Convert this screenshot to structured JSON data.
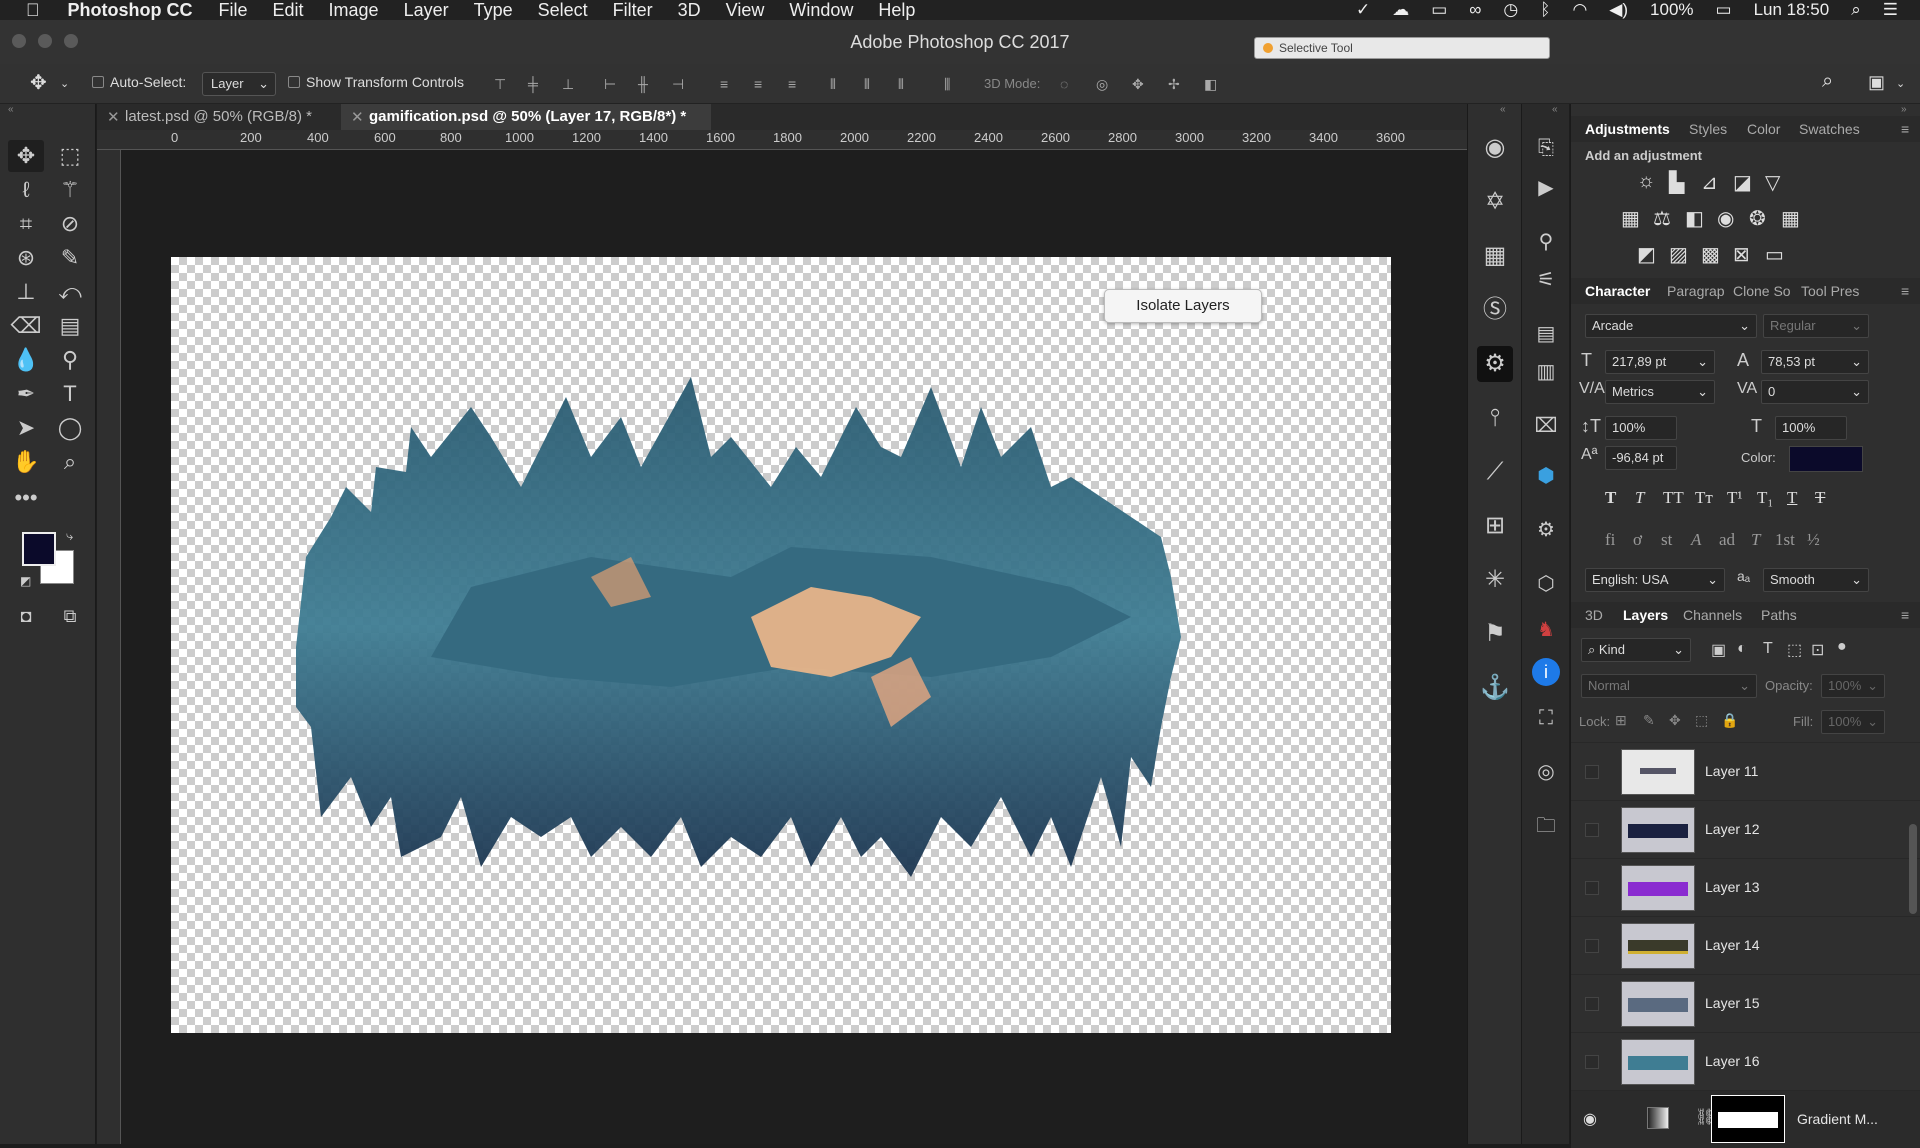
{
  "menubar": {
    "apple": "",
    "app": "Photoshop CC",
    "items": [
      "File",
      "Edit",
      "Image",
      "Layer",
      "Type",
      "Select",
      "Filter",
      "3D",
      "View",
      "Window",
      "Help"
    ],
    "battery": "100%",
    "time": "Lun 18:50"
  },
  "window": {
    "title": "Adobe Photoshop CC 2017",
    "selective_tool": "Selective Tool"
  },
  "options": {
    "auto_select": "Auto-Select:",
    "auto_select_value": "Layer",
    "show_transform": "Show Transform Controls",
    "mode_3d": "3D Mode:"
  },
  "tabs": [
    {
      "label": "latest.psd @ 50% (RGB/8) *"
    },
    {
      "label": "gamification.psd @ 50% (Layer 17, RGB/8*) *"
    }
  ],
  "ruler": {
    "h": [
      "0",
      "200",
      "400",
      "600",
      "800",
      "1000",
      "1200",
      "1400",
      "1600",
      "1800",
      "2000",
      "2200",
      "2400",
      "2600",
      "2800",
      "3000",
      "3200",
      "3400",
      "3600"
    ]
  },
  "canvas": {
    "isolate_button": "Isolate Layers"
  },
  "adjustments": {
    "tabs": [
      "Adjustments",
      "Styles",
      "Color",
      "Swatches"
    ],
    "subtitle": "Add an adjustment"
  },
  "character": {
    "tabs": [
      "Character",
      "Paragrap",
      "Clone So",
      "Tool Pres"
    ],
    "font": "Arcade",
    "style": "Regular",
    "size": "217,89 pt",
    "leading": "78,53 pt",
    "kerning": "Metrics",
    "tracking": "0",
    "vscale": "100%",
    "hscale": "100%",
    "baseline": "-96,84 pt",
    "color_label": "Color:",
    "color": "#0b0a2a",
    "language": "English: USA",
    "aa_label": "aₐ",
    "antialias": "Smooth"
  },
  "layers_panel": {
    "tabs": [
      "3D",
      "Layers",
      "Channels",
      "Paths"
    ],
    "filter": "Kind",
    "blend": "Normal",
    "opacity_label": "Opacity:",
    "opacity": "100%",
    "lock_label": "Lock:",
    "fill_label": "Fill:",
    "fill": "100%",
    "layers": [
      {
        "name": "Layer 11"
      },
      {
        "name": "Layer 12"
      },
      {
        "name": "Layer 13"
      },
      {
        "name": "Layer 14"
      },
      {
        "name": "Layer 15"
      },
      {
        "name": "Layer 16"
      },
      {
        "name": "Gradient M..."
      }
    ]
  },
  "colors": {
    "foreground": "#0b0a2a",
    "background": "#ffffff"
  }
}
